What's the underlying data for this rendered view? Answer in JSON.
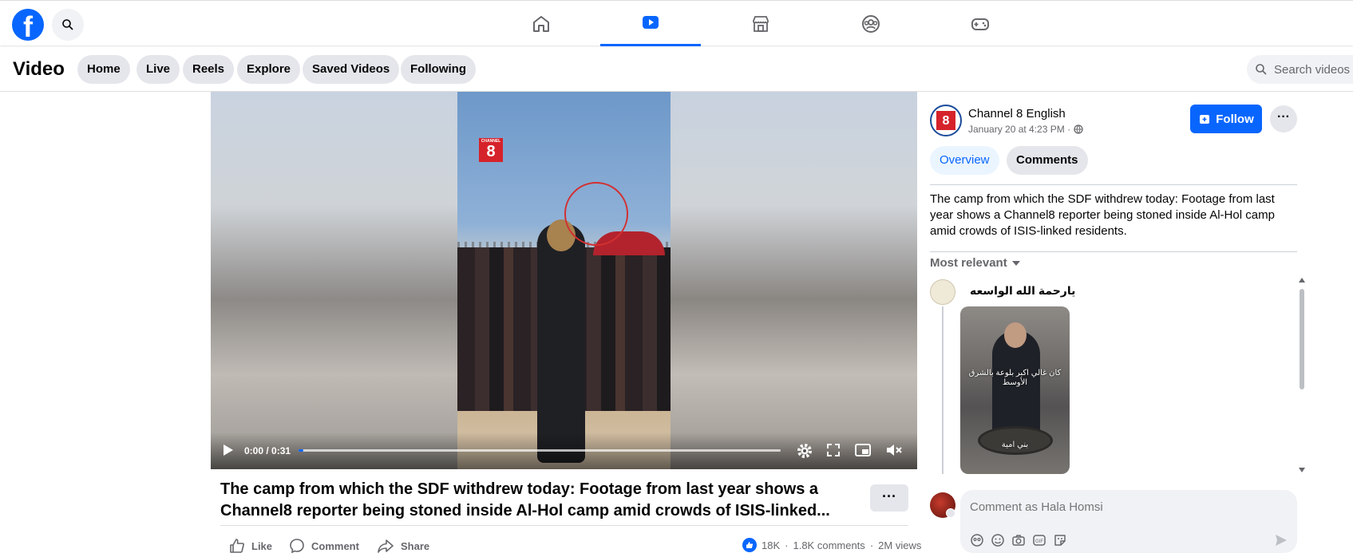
{
  "topnav": {
    "logo": "f",
    "tabs": [
      "home-icon",
      "video-icon",
      "marketplace-icon",
      "groups-icon",
      "gaming-icon"
    ],
    "active_tab": "video"
  },
  "subnav": {
    "title": "Video",
    "chips": [
      "Home",
      "Live",
      "Reels",
      "Explore",
      "Saved Videos",
      "Following"
    ],
    "search_placeholder": "Search videos"
  },
  "player": {
    "channel_logo_top": "CHANNEL",
    "channel_logo_num": "8",
    "time": "0:00 / 0:31",
    "progress": 0.0
  },
  "post": {
    "title": "The camp from which the SDF withdrew today: Footage from last year shows a Channel8 reporter being stoned inside Al-Hol camp amid crowds of ISIS-linked...",
    "more": "···",
    "actions": {
      "like": "Like",
      "comment": "Comment",
      "share": "Share"
    },
    "stats": {
      "reactions": "18K",
      "comments": "1.8K comments",
      "views": "2M views",
      "sep": "·"
    }
  },
  "side": {
    "page_name": "Channel 8 English",
    "date": "January 20 at 4:23 PM · ",
    "follow": "Follow",
    "more": "···",
    "tabs": {
      "overview": "Overview",
      "comments": "Comments"
    },
    "description": "The camp from which the SDF withdrew today: Footage from last year shows a Channel8 reporter being stoned inside Al-Hol camp amid crowds of ISIS-linked residents.",
    "sort": "Most relevant",
    "comment": {
      "author": "يارحمة الله الواسعه",
      "image_text_1": "كان غالي اكبر بلوعة بالشرق الأوسط",
      "image_text_2": "بني امية"
    },
    "composer_placeholder": "Comment as Hala Homsi"
  },
  "colors": {
    "brand": "#0866ff",
    "chip_bg": "#e4e6eb",
    "muted": "#65676b"
  }
}
